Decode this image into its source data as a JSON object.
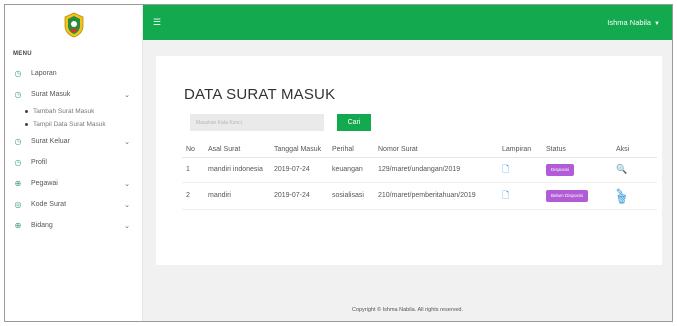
{
  "sidebar": {
    "menu_title": "MENU",
    "items": [
      {
        "label": "Laporan",
        "icon": "clock-icon"
      },
      {
        "label": "Surat Masuk",
        "icon": "clock-icon",
        "expanded": true
      },
      {
        "label": "Surat Keluar",
        "icon": "clock-icon"
      },
      {
        "label": "Profil",
        "icon": "clock-icon"
      },
      {
        "label": "Pegawai",
        "icon": "globe-icon"
      },
      {
        "label": "Kode Surat",
        "icon": "layers-icon"
      },
      {
        "label": "Bidang",
        "icon": "globe-icon"
      }
    ],
    "sub_items": [
      {
        "label": "Tambah Surat Masuk"
      },
      {
        "label": "Tampil Data Surat Masuk"
      }
    ]
  },
  "topbar": {
    "user_name": "Ishma Nabila",
    "color": "#12a94f"
  },
  "main": {
    "title": "DATA SURAT MASUK",
    "search_placeholder": "Masukan Kata Kunci",
    "search_button": "Cari",
    "table": {
      "headers": [
        "No",
        "Asal Surat",
        "Tanggal Masuk",
        "Perihal",
        "Nomor Surat",
        "Lampiran",
        "Status",
        "Aksi"
      ],
      "rows": [
        {
          "no": "1",
          "asal": "mandiri indonesia",
          "tanggal": "2019-07-24",
          "perihal": "keuangan",
          "nomor": "129/maret/undangan/2019",
          "status": "Disposisi"
        },
        {
          "no": "2",
          "asal": "mandiri",
          "tanggal": "2019-07-24",
          "perihal": "sosialisasi",
          "nomor": "210/maret/pemberitahuan/2019",
          "status": "Belum Disposisi"
        }
      ]
    }
  },
  "footer": {
    "text": "Copyright © Ishma Nabila. All rights reserved."
  },
  "colors": {
    "accent": "#12a94f",
    "badge": "#b15cd6",
    "link": "#2a8fd6"
  }
}
